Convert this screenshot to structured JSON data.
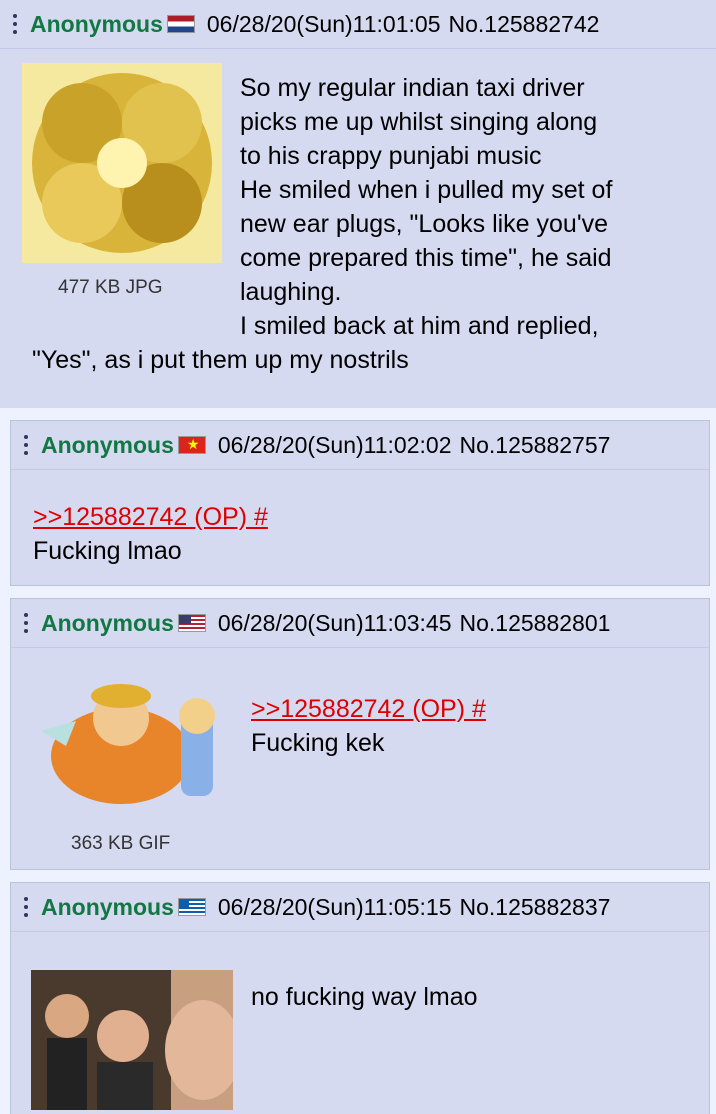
{
  "posts": [
    {
      "name": "Anonymous",
      "flag": "netherlands-flag",
      "datetime": "06/28/20(Sun)11:01:05",
      "number": "No.125882742",
      "file_info": "477 KB JPG",
      "lines": [
        "So my regular indian taxi driver",
        "picks me up whilst singing along",
        "to his crappy punjabi music",
        "He smiled when i pulled my set of",
        "new ear plugs, \"Looks like you've",
        "come prepared this time\", he said",
        "laughing.",
        "I smiled back at him and replied,",
        "\"Yes\", as i put them up my nostrils"
      ]
    },
    {
      "name": "Anonymous",
      "flag": "vietnam-flag",
      "datetime": "06/28/20(Sun)11:02:02",
      "number": "No.125882757",
      "quote": ">>125882742 (OP) #",
      "text": "Fucking lmao"
    },
    {
      "name": "Anonymous",
      "flag": "usa-flag",
      "datetime": "06/28/20(Sun)11:03:45",
      "number": "No.125882801",
      "file_info": "363 KB GIF",
      "quote": ">>125882742 (OP) #",
      "text": "Fucking kek"
    },
    {
      "name": "Anonymous",
      "flag": "greece-flag",
      "datetime": "06/28/20(Sun)11:05:15",
      "number": "No.125882837",
      "text": "no fucking way lmao"
    }
  ],
  "colors": {
    "name": "#117743",
    "quote": "#dd0000",
    "post_bg": "#d6daf0",
    "page_bg": "#eef2ff"
  }
}
